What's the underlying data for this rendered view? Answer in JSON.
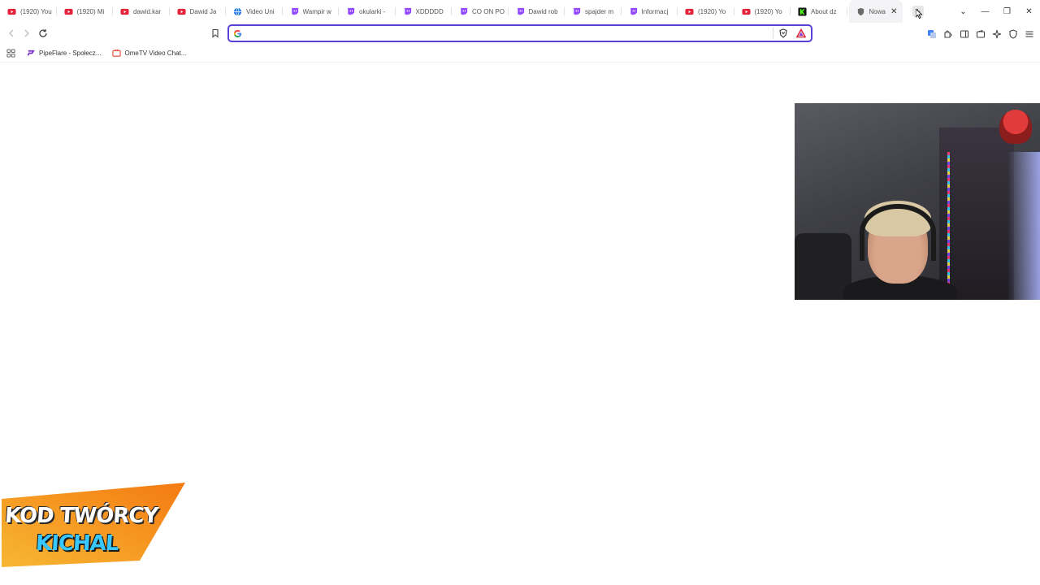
{
  "browser": {
    "tabs": [
      {
        "title": "(1920) You",
        "favicon": "youtube-icon"
      },
      {
        "title": "(1920) Mi",
        "favicon": "youtube-icon"
      },
      {
        "title": "dawid.kar",
        "favicon": "youtube-icon"
      },
      {
        "title": "Dawid Ja",
        "favicon": "youtube-icon"
      },
      {
        "title": "Video Uni",
        "favicon": "globe-icon"
      },
      {
        "title": "Wampir w",
        "favicon": "twitch-icon"
      },
      {
        "title": "okularki -",
        "favicon": "twitch-icon"
      },
      {
        "title": "XDDDDD",
        "favicon": "twitch-icon"
      },
      {
        "title": "CO ON PO",
        "favicon": "twitch-icon"
      },
      {
        "title": "Dawid rob",
        "favicon": "twitch-icon"
      },
      {
        "title": "spajder m",
        "favicon": "twitch-icon"
      },
      {
        "title": "Informacj",
        "favicon": "twitch-icon"
      },
      {
        "title": "(1920) Yo",
        "favicon": "youtube-icon"
      },
      {
        "title": "(1920) Yo",
        "favicon": "youtube-icon"
      },
      {
        "title": "About dz",
        "favicon": "kick-icon"
      }
    ],
    "active_tab": {
      "title": "Nowa",
      "close_label": "✕"
    },
    "new_tab_label": "+",
    "window_controls": {
      "dropdown": "⌄",
      "minimize": "—",
      "restore": "❐",
      "close": "✕"
    },
    "omnibox": {
      "value": "",
      "placeholder": ""
    },
    "bookmarks": [
      {
        "label": "PipeFlare - Społecz...",
        "icon": "pipeflare-icon"
      },
      {
        "label": "OmeTV Video Chat...",
        "icon": "ometv-icon"
      }
    ]
  },
  "overlay": {
    "banner_line1": "KOD TWÓRCY",
    "banner_line2": "KICHAL"
  },
  "colors": {
    "omnibox_border": "#5b3fd4",
    "youtube": "#e5243b",
    "twitch": "#9146ff",
    "kick": "#53fc18",
    "banner_orange": "#f59a1b",
    "banner_blue": "#38c8ff"
  }
}
